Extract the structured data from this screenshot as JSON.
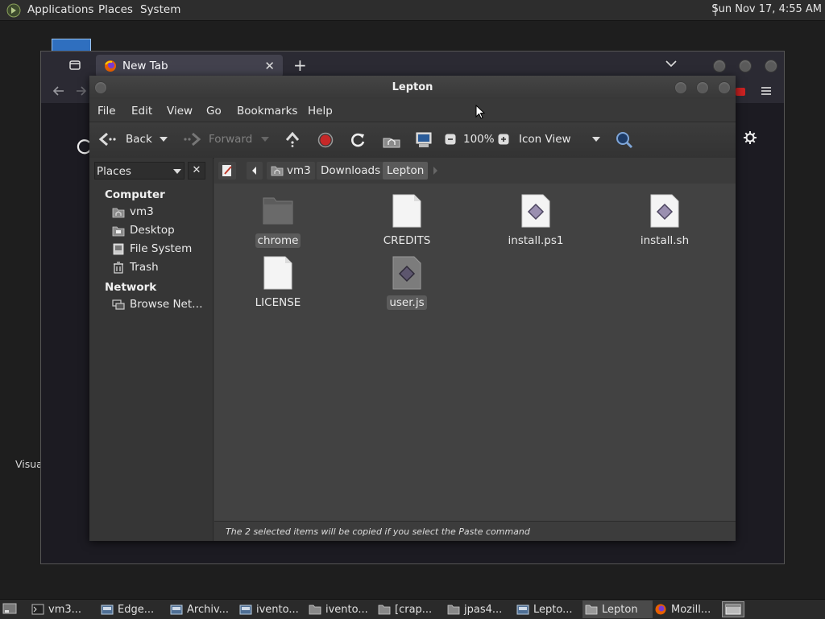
{
  "top_panel": {
    "menus": [
      "Applications",
      "Places",
      "System"
    ],
    "clock": "Sun Nov 17,  4:55 AM"
  },
  "desktop": {
    "partial_label": "Visua"
  },
  "firefox": {
    "tab_title": "New Tab",
    "new_tab_symbol": "+"
  },
  "file_manager": {
    "title": "Lepton",
    "menus": [
      "File",
      "Edit",
      "View",
      "Go",
      "Bookmarks",
      "Help"
    ],
    "toolbar": {
      "back_label": "Back",
      "forward_label": "Forward",
      "zoom": "100%",
      "view_mode": "Icon View"
    },
    "sidebar": {
      "selector": "Places",
      "computer_heading": "Computer",
      "computer_items": [
        "vm3",
        "Desktop",
        "File System",
        "Trash"
      ],
      "network_heading": "Network",
      "network_items": [
        "Browse Net…"
      ]
    },
    "path": [
      "vm3",
      "Downloads",
      "Lepton"
    ],
    "files": [
      {
        "name": "chrome",
        "icon": "folder-icon",
        "selected": true
      },
      {
        "name": "CREDITS",
        "icon": "text-file-icon",
        "selected": false
      },
      {
        "name": "install.ps1",
        "icon": "script-file-icon",
        "selected": false
      },
      {
        "name": "install.sh",
        "icon": "script-file-icon",
        "selected": false
      },
      {
        "name": "LICENSE",
        "icon": "text-file-icon",
        "selected": false
      },
      {
        "name": "user.js",
        "icon": "script-file-icon",
        "selected": true
      }
    ],
    "status": "The 2 selected items will be copied if you select the Paste command"
  },
  "taskbar": {
    "items": [
      {
        "label": "vm3...",
        "icon": "terminal-icon",
        "active": false
      },
      {
        "label": "Edge...",
        "icon": "app-icon",
        "active": false
      },
      {
        "label": "Archiv...",
        "icon": "app-icon",
        "active": false
      },
      {
        "label": "ivento...",
        "icon": "app-icon",
        "active": false
      },
      {
        "label": "ivento...",
        "icon": "folder-icon",
        "active": false
      },
      {
        "label": "[crap...",
        "icon": "folder-icon",
        "active": false
      },
      {
        "label": "jpas4...",
        "icon": "folder-icon",
        "active": false
      },
      {
        "label": "Lepto...",
        "icon": "app-icon",
        "active": false
      },
      {
        "label": "Lepton",
        "icon": "folder-icon",
        "active": true
      },
      {
        "label": "Mozill...",
        "icon": "firefox-icon",
        "active": false
      }
    ]
  }
}
